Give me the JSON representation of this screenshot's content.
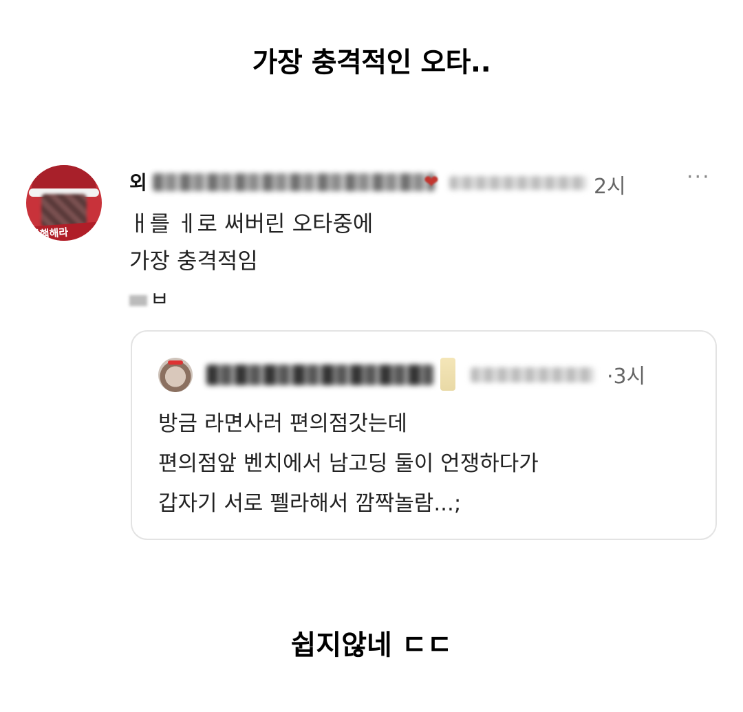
{
  "headline": "가장 충격적인 오타..",
  "post": {
    "author_prefix": "외",
    "time": "2시",
    "more_icon": "more-horizontal-icon",
    "lines": [
      "ㅐ를 ㅔ로 써버린 오타중에",
      "가장 충격적임"
    ],
    "extra": "ㅂ",
    "avatar_banner": "탄핵해라",
    "quote": {
      "time": "3시",
      "lines": [
        "방금 라면사러 편의점갓는데",
        "편의점앞 벤치에서 남고딩 둘이 언쟁하다가",
        "갑자기 서로 펠라해서 깜짝놀람...;"
      ]
    }
  },
  "footline": "쉽지않네 ㄷㄷ"
}
